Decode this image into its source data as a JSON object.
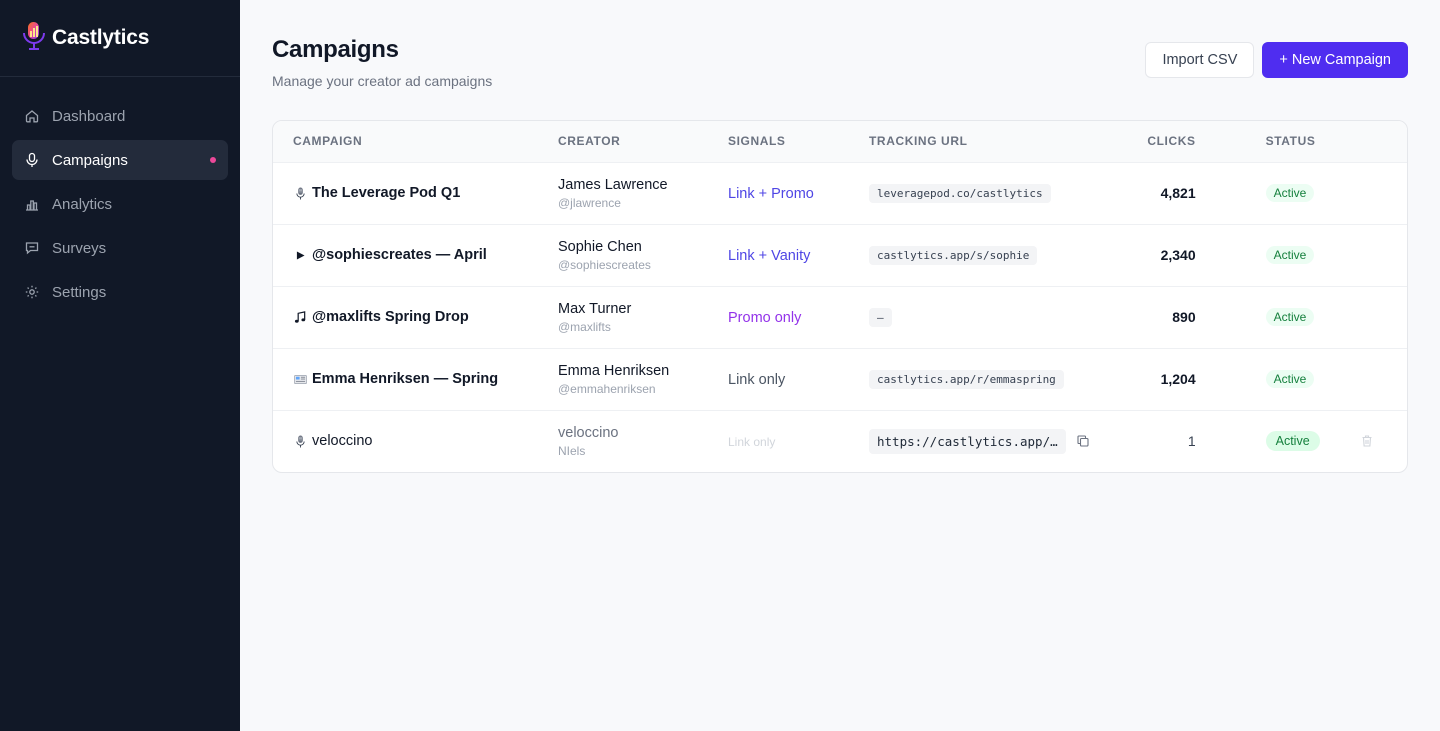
{
  "app": {
    "name": "Castlytics"
  },
  "sidebar": {
    "items": [
      {
        "label": "Dashboard",
        "icon": "home-icon",
        "active": false
      },
      {
        "label": "Campaigns",
        "icon": "microphone-icon",
        "active": true,
        "indicator_color": "#ec4899"
      },
      {
        "label": "Analytics",
        "icon": "bar-chart-icon",
        "active": false
      },
      {
        "label": "Surveys",
        "icon": "chat-bubble-icon",
        "active": false
      },
      {
        "label": "Settings",
        "icon": "gear-icon",
        "active": false
      }
    ]
  },
  "header": {
    "title": "Campaigns",
    "subtitle": "Manage your creator ad campaigns",
    "import_label": "Import CSV",
    "new_label": "+ New Campaign"
  },
  "table": {
    "columns": [
      "CAMPAIGN",
      "CREATOR",
      "SIGNALS",
      "TRACKING URL",
      "CLICKS",
      "STATUS"
    ],
    "rows": [
      {
        "icon": "microphone-icon",
        "campaign": "The Leverage Pod Q1",
        "creator_name": "James Lawrence",
        "creator_handle": "@jlawrence",
        "signals": "Link + Promo",
        "signal_tone": "purple",
        "url": "leveragepod.co/castlytics",
        "clicks": "4,821",
        "status": "Active"
      },
      {
        "icon": "play-icon",
        "campaign": "@sophiescreates — April",
        "creator_name": "Sophie Chen",
        "creator_handle": "@sophiescreates",
        "signals": "Link + Vanity",
        "signal_tone": "purple",
        "url": "castlytics.app/s/sophie",
        "clicks": "2,340",
        "status": "Active"
      },
      {
        "icon": "music-note-icon",
        "campaign": "@maxlifts Spring Drop",
        "creator_name": "Max Turner",
        "creator_handle": "@maxlifts",
        "signals": "Promo only",
        "signal_tone": "violet",
        "url": "—",
        "clicks": "890",
        "status": "Active"
      },
      {
        "icon": "newsletter-icon",
        "campaign": "Emma Henriksen — Spring",
        "creator_name": "Emma Henriksen",
        "creator_handle": "@emmahenriksen",
        "signals": "Link only",
        "signal_tone": "gray",
        "url": "castlytics.app/r/emmaspring",
        "clicks": "1,204",
        "status": "Active"
      },
      {
        "icon": "microphone-icon",
        "campaign": "veloccino",
        "creator_name": "veloccino",
        "creator_handle": "NIels",
        "signals": "Link only",
        "signal_tone": "faint",
        "url": "https://castlytics.app/…",
        "clicks": "1",
        "status": "Active"
      }
    ]
  },
  "colors": {
    "sidebar_bg": "#111827",
    "primary": "#4f2df0",
    "active_badge": "#15803d"
  }
}
